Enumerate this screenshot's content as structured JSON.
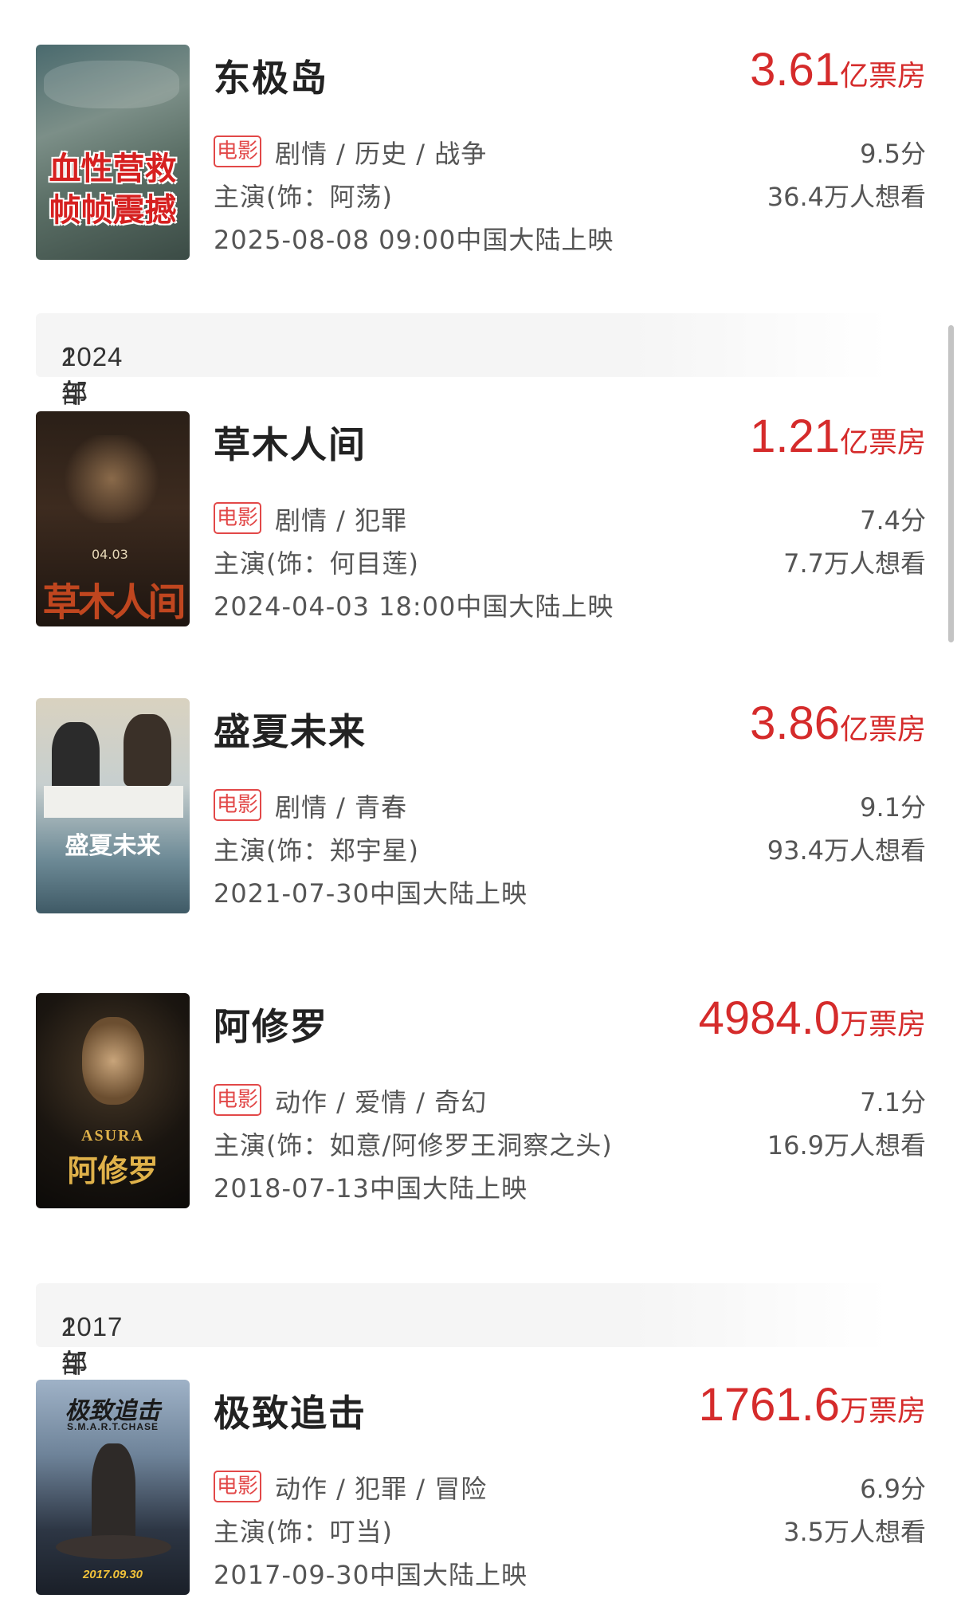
{
  "sections": [
    {
      "year_label": "2024年",
      "count_label": "1部"
    },
    {
      "year_label": "2017年",
      "count_label": "1部"
    }
  ],
  "movies": [
    {
      "title": "东极岛",
      "box_value": "3.61",
      "box_unit": "亿票房",
      "tag": "电影",
      "genre": "剧情 / 历史 / 战争",
      "cast": "主演(饰：阿荡)",
      "release": "2025-08-08 09:00中国大陆上映",
      "score": "9.5分",
      "want": "36.4万人想看",
      "poster_text": "血性营救\n帧帧震撼"
    },
    {
      "title": "草木人间",
      "box_value": "1.21",
      "box_unit": "亿票房",
      "tag": "电影",
      "genre": "剧情 / 犯罪",
      "cast": "主演(饰：何目莲)",
      "release": "2024-04-03 18:00中国大陆上映",
      "score": "7.4分",
      "want": "7.7万人想看",
      "poster_text": "草木人间"
    },
    {
      "title": "盛夏未来",
      "box_value": "3.86",
      "box_unit": "亿票房",
      "tag": "电影",
      "genre": "剧情 / 青春",
      "cast": "主演(饰：郑宇星)",
      "release": "2021-07-30中国大陆上映",
      "score": "9.1分",
      "want": "93.4万人想看",
      "poster_text": "盛夏未来"
    },
    {
      "title": "阿修罗",
      "box_value": "4984.0",
      "box_unit": "万票房",
      "tag": "电影",
      "genre": "动作 / 爱情 / 奇幻",
      "cast": "主演(饰：如意/阿修罗王洞察之头)",
      "release": "2018-07-13中国大陆上映",
      "score": "7.1分",
      "want": "16.9万人想看",
      "poster_text": "阿修罗",
      "poster_en": "ASURA"
    },
    {
      "title": "极致追击",
      "box_value": "1761.6",
      "box_unit": "万票房",
      "tag": "电影",
      "genre": "动作 / 犯罪 / 冒险",
      "cast": "主演(饰：叮当)",
      "release": "2017-09-30中国大陆上映",
      "score": "6.9分",
      "want": "3.5万人想看",
      "poster_text": "极致追击",
      "poster_en": "S.M.A.R.T.CHASE",
      "poster_date": "2017.09.30"
    }
  ],
  "colors": {
    "accent": "#d52b2b",
    "tag": "#e24848"
  }
}
